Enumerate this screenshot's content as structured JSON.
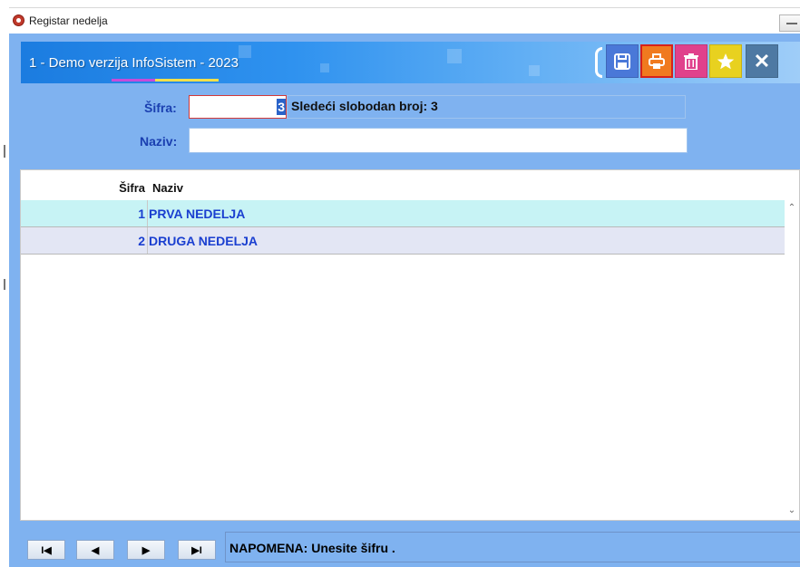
{
  "window": {
    "title": "Registar nedelja"
  },
  "banner": {
    "company": "1 - Demo verzija InfoSistem - 2023"
  },
  "toolbar": {
    "buttons": [
      {
        "name": "save",
        "icon": "floppy-disk-icon"
      },
      {
        "name": "print",
        "icon": "printer-icon"
      },
      {
        "name": "delete",
        "icon": "trash-icon"
      },
      {
        "name": "favorite",
        "icon": "star-icon"
      },
      {
        "name": "close",
        "icon": "close-icon",
        "glyph": "✕"
      }
    ]
  },
  "form": {
    "code_label": "Šifra:",
    "code_value": "3",
    "next_free": "Sledeći slobodan broj: 3",
    "name_label": "Naziv:",
    "name_value": ""
  },
  "grid": {
    "columns": [
      "Šifra",
      "Naziv"
    ],
    "rows": [
      {
        "sifra": "1",
        "naziv": "PRVA NEDELJA"
      },
      {
        "sifra": "2",
        "naziv": "DRUGA NEDELJA"
      }
    ]
  },
  "navigation": {
    "first": "I◀",
    "prev": "◀",
    "next": "▶",
    "last": "▶I"
  },
  "status": {
    "note": "NAPOMENA: Unesite šifru ."
  },
  "colors": {
    "frame": "#7fb2f0",
    "label": "#1a3fb0",
    "row_selected": "#c7f3f5",
    "row_alt": "#e3e6f4"
  }
}
